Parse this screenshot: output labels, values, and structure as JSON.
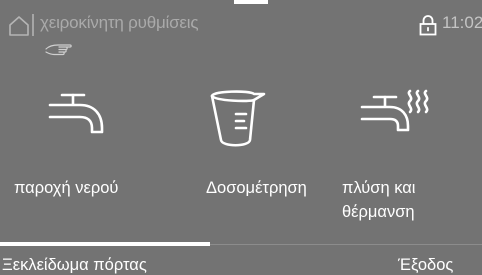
{
  "header": {
    "title": "χειροκίνητη ρυθμίσεις",
    "time": "11:02",
    "home_icon": "home-icon",
    "lock_icon": "lock-icon",
    "hand_icon": "hand-pointer-icon"
  },
  "tiles": [
    {
      "label": "παροχή νερού",
      "icon": "faucet-icon"
    },
    {
      "label": "Δοσομέτρηση",
      "icon": "measuring-cup-icon"
    },
    {
      "label_line1": "πλύση και",
      "label_line2": "θέρμανση",
      "icon": "faucet-steam-icon"
    }
  ],
  "footer": {
    "left_label": "Ξεκλείδωμα πόρτας",
    "right_label": "Έξοδος"
  },
  "colors": {
    "background": "#737373",
    "foreground": "#ffffff",
    "muted_text": "#aaaaaa"
  }
}
